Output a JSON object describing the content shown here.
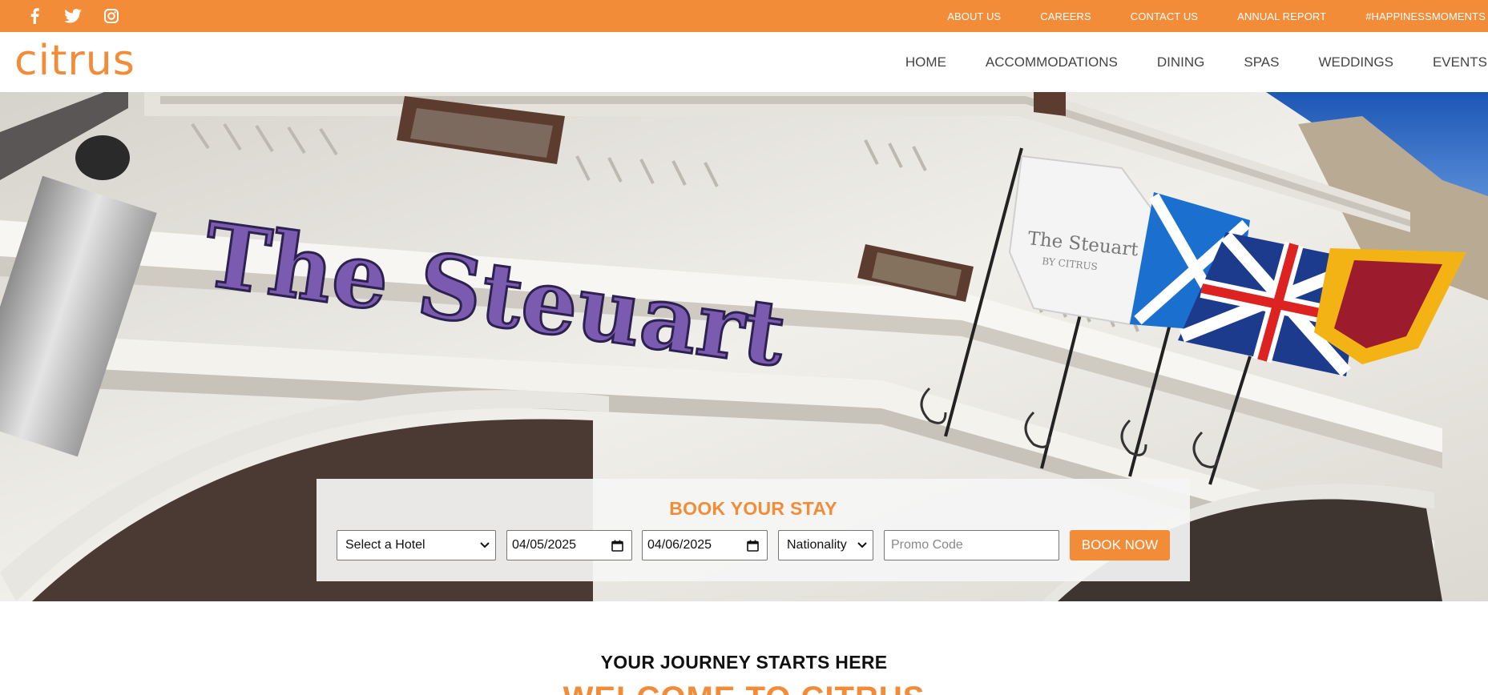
{
  "social": {
    "icons": [
      "facebook-icon",
      "twitter-icon",
      "instagram-icon"
    ]
  },
  "top_links": [
    "ABOUT US",
    "CAREERS",
    "CONTACT US",
    "ANNUAL REPORT",
    "#HAPPINESSMOMENTS"
  ],
  "brand": {
    "logo": "citrus",
    "accent_color": "#f28c38"
  },
  "main_nav": [
    "HOME",
    "ACCOMMODATIONS",
    "DINING",
    "SPAS",
    "WEDDINGS",
    "EVENTS"
  ],
  "hero": {
    "sign_text": "The Steuart",
    "flag_text": "The Steuart",
    "flag_subtext": "BY CITRUS"
  },
  "booking": {
    "title": "BOOK YOUR STAY",
    "hotel_select": "Select a Hotel",
    "check_in": "04/05/2025",
    "check_out": "04/06/2025",
    "nationality_select": "Nationality",
    "promo_placeholder": "Promo Code",
    "book_button": "BOOK NOW"
  },
  "intro": {
    "subtitle": "YOUR JOURNEY STARTS HERE",
    "title": "WELCOME TO CITRUS"
  }
}
